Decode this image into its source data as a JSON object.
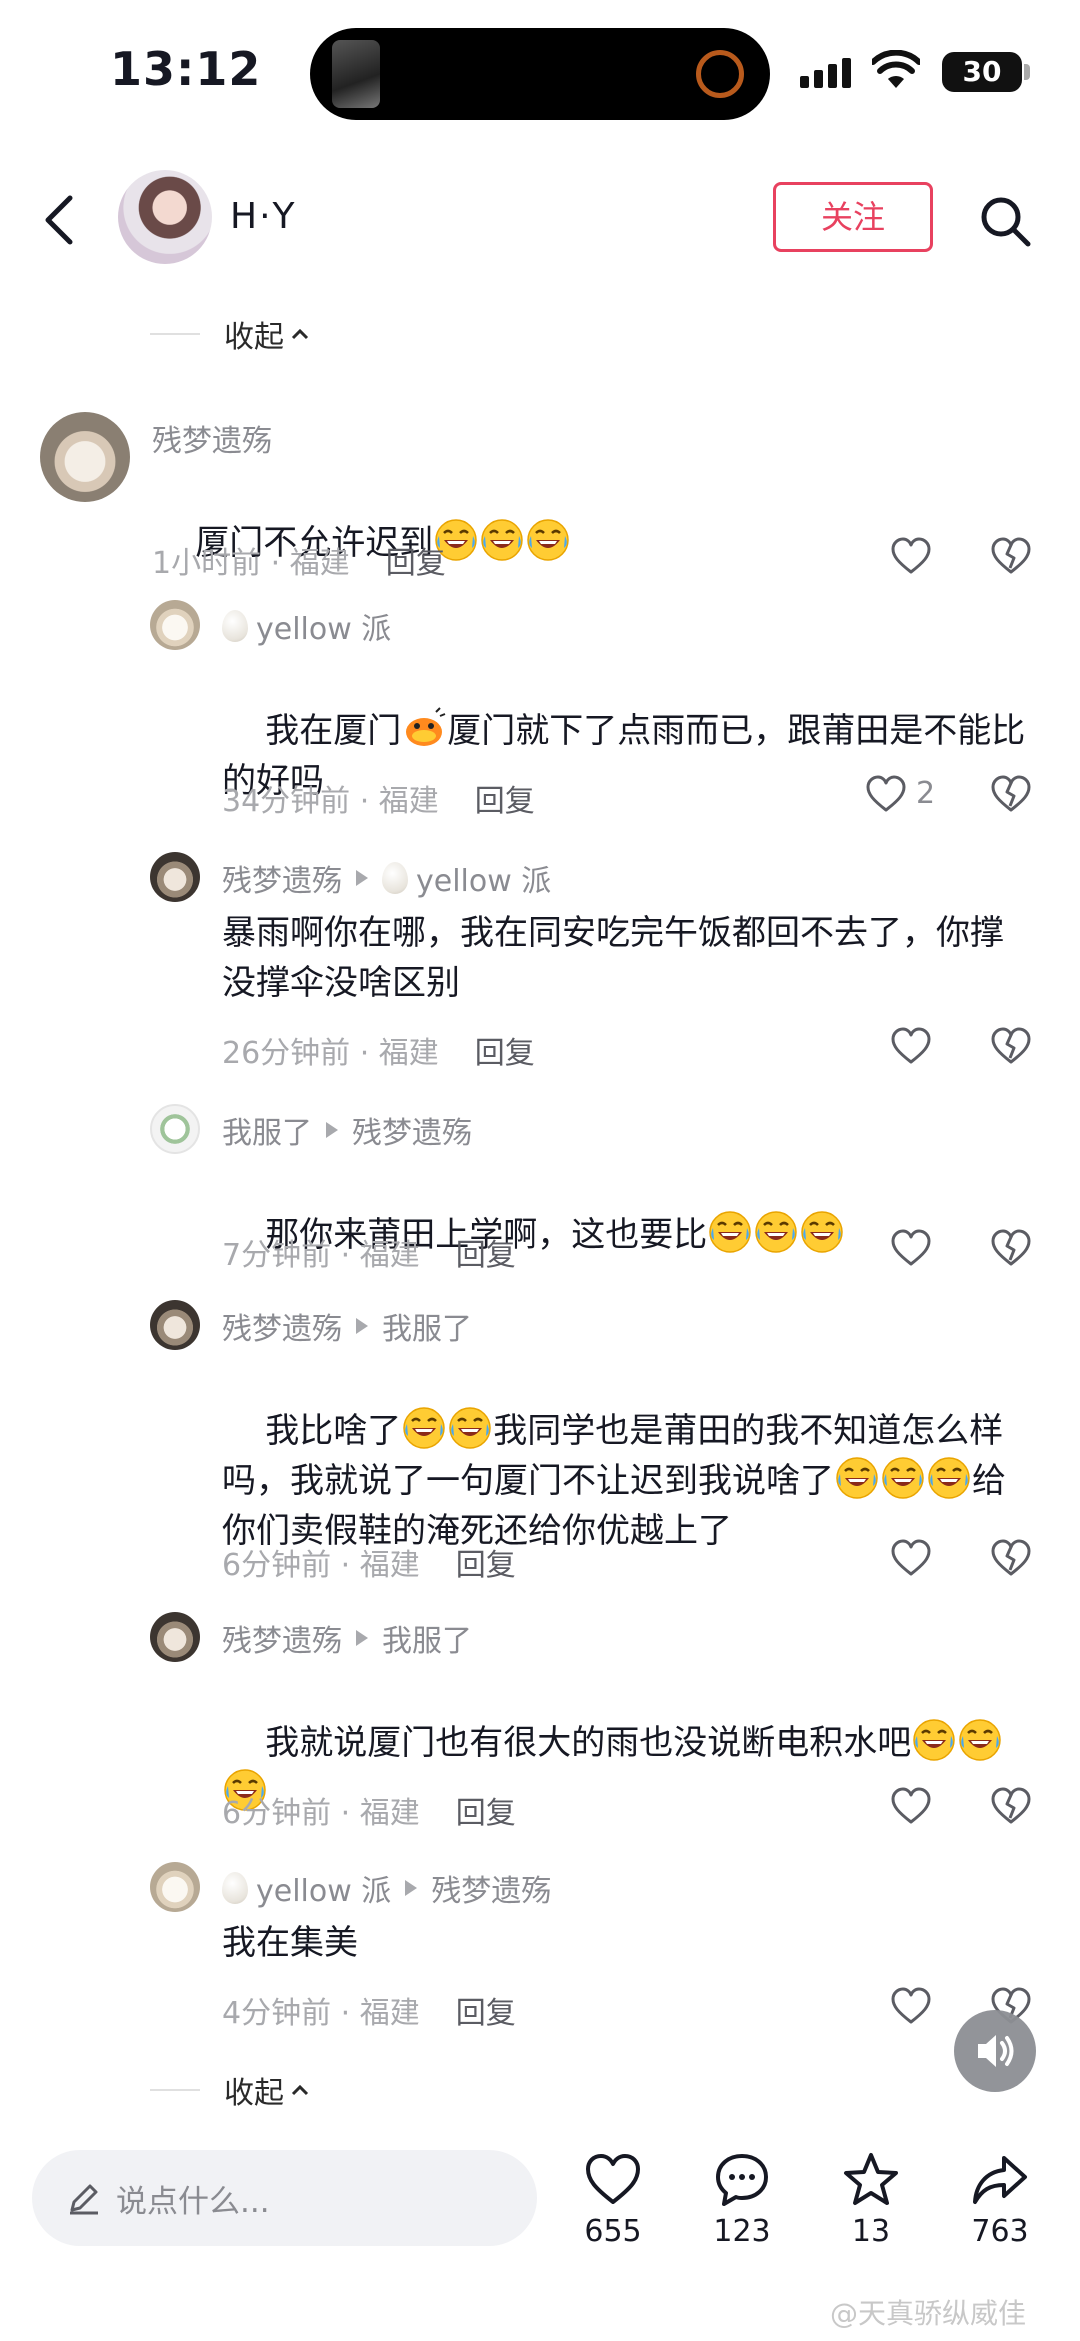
{
  "status_bar": {
    "time": "13:12",
    "battery": "30"
  },
  "header": {
    "username": "H·Y",
    "follow_label": "关注"
  },
  "collapse_label": "收起",
  "comments": [
    {
      "author": "残梦遗殇",
      "text": "厦门不允许迟到",
      "emojis_after": 3,
      "time_location": "1小时前 · 福建",
      "reply_label": "回复"
    },
    {
      "author": "yellow 派",
      "reply_to": "",
      "text_before": "我在厦门",
      "text_after": "厦门就下了点雨而已，跟莆田是不能比的好吗",
      "time_location": "34分钟前 · 福建",
      "reply_label": "回复",
      "likes": "2"
    },
    {
      "author": "残梦遗殇",
      "reply_to": "yellow 派",
      "text": "暴雨啊你在哪，我在同安吃完午饭都回不去了，你撑没撑伞没啥区别",
      "time_location": "26分钟前 · 福建",
      "reply_label": "回复"
    },
    {
      "author": "我服了",
      "reply_to": "残梦遗殇",
      "text": "那你来莆田上学啊，这也要比",
      "time_location": "7分钟前 · 福建",
      "reply_label": "回复"
    },
    {
      "author": "残梦遗殇",
      "reply_to": "我服了",
      "text_a": "我比啥了",
      "text_b": "我同学也是莆田的我不知道怎么样吗，我就说了一句厦门不让迟到我说啥了",
      "text_c": "给你们卖假鞋的淹死还给你优越上了",
      "time_location": "6分钟前 · 福建",
      "reply_label": "回复"
    },
    {
      "author": "残梦遗殇",
      "reply_to": "我服了",
      "text": "我就说厦门也有很大的雨也没说断电积水吧",
      "time_location": "6分钟前 · 福建",
      "reply_label": "回复"
    },
    {
      "author": "yellow 派",
      "reply_to": "残梦遗殇",
      "text": "我在集美",
      "time_location": "4分钟前 · 福建",
      "reply_label": "回复"
    }
  ],
  "input_placeholder": "说点什么...",
  "actions": {
    "likes": "655",
    "comments": "123",
    "favorites": "13",
    "shares": "763"
  },
  "watermark": "@天真骄纵威佳"
}
